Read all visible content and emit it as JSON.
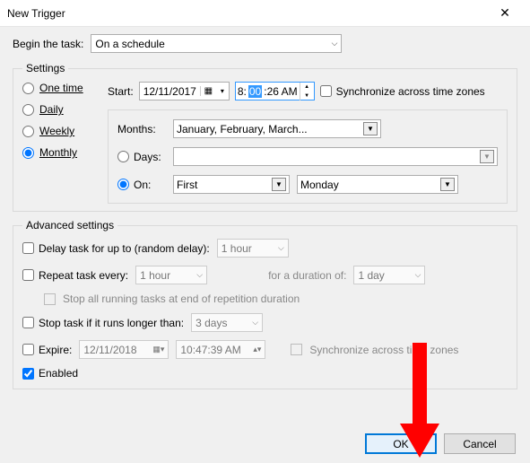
{
  "window": {
    "title": "New Trigger"
  },
  "begin": {
    "label": "Begin the task:",
    "value": "On a schedule"
  },
  "settings": {
    "legend": "Settings",
    "schedules": {
      "onetime": "One time",
      "daily": "Daily",
      "weekly": "Weekly",
      "monthly": "Monthly"
    },
    "start_label": "Start:",
    "start_date": "12/11/2017",
    "start_time_prefix": "8:",
    "start_time_sel": "00",
    "start_time_suffix": ":26 AM",
    "sync_label": "Synchronize across time zones",
    "months_label": "Months:",
    "months_value": "January, February, March...",
    "days_label": "Days:",
    "on_label": "On:",
    "on_week": "First",
    "on_day": "Monday"
  },
  "advanced": {
    "legend": "Advanced settings",
    "delay_label": "Delay task for up to (random delay):",
    "delay_value": "1 hour",
    "repeat_label": "Repeat task every:",
    "repeat_value": "1 hour",
    "duration_label": "for a duration of:",
    "duration_value": "1 day",
    "stop_rep_label": "Stop all running tasks at end of repetition duration",
    "stop_long_label": "Stop task if it runs longer than:",
    "stop_long_value": "3 days",
    "expire_label": "Expire:",
    "expire_date": "12/11/2018",
    "expire_time": "10:47:39 AM",
    "expire_sync_label": "Synchronize across time zones",
    "enabled_label": "Enabled"
  },
  "buttons": {
    "ok": "OK",
    "cancel": "Cancel"
  }
}
